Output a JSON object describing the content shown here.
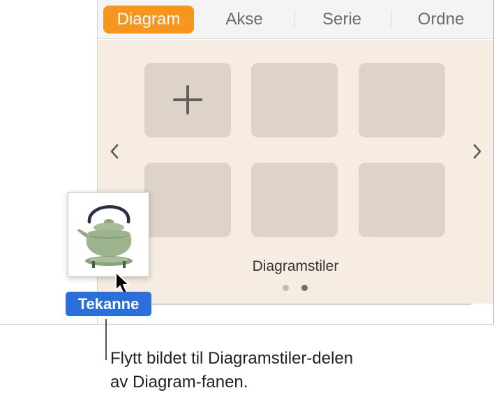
{
  "tabs": [
    {
      "label": "Diagram",
      "active": true
    },
    {
      "label": "Akse",
      "active": false
    },
    {
      "label": "Serie",
      "active": false
    },
    {
      "label": "Ordne",
      "active": false
    }
  ],
  "panel": {
    "section_label": "Diagramstiler",
    "tile_count": 6,
    "add_tile_symbol": "+",
    "prev_icon": "chevron-left-icon",
    "next_icon": "chevron-right-icon",
    "pages": 2,
    "current_page": 2
  },
  "drag": {
    "label": "Tekanne",
    "image": "teapot-image",
    "cursor": "arrow-pointer-icon"
  },
  "caption": {
    "line1": "Flytt bildet til Diagramstiler-delen",
    "line2": "av Diagram-fanen."
  },
  "colors": {
    "active_tab": "#f7961f",
    "panel_bg": "#f6ece1",
    "tile": "#ddd3c9",
    "drag_label": "#2a6fdb",
    "teapot": "#9cb48e"
  }
}
